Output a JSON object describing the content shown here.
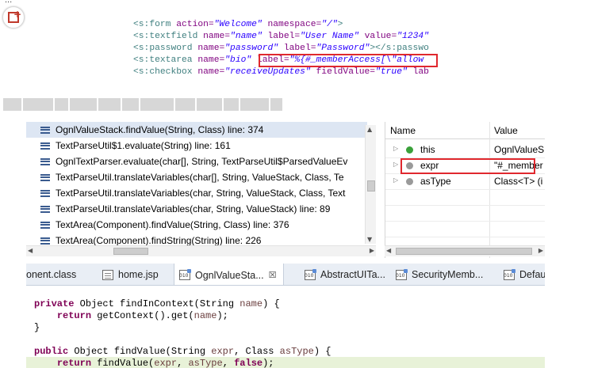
{
  "top_fragment": "...",
  "jsp_code": {
    "lines": [
      [
        {
          "c": "tag",
          "t": "<s:form "
        },
        {
          "c": "attr",
          "t": "action="
        },
        {
          "c": "val",
          "t": "\"Welcome\""
        },
        {
          "c": "plain",
          "t": " "
        },
        {
          "c": "attr",
          "t": "namespace="
        },
        {
          "c": "val",
          "t": "\"/\""
        },
        {
          "c": "tag",
          "t": ">"
        }
      ],
      [
        {
          "c": "tag",
          "t": "<s:textfield "
        },
        {
          "c": "attr",
          "t": "name="
        },
        {
          "c": "val",
          "t": "\"name\""
        },
        {
          "c": "plain",
          "t": " "
        },
        {
          "c": "attr",
          "t": "label="
        },
        {
          "c": "val",
          "t": "\"User Name\""
        },
        {
          "c": "plain",
          "t": " "
        },
        {
          "c": "attr",
          "t": "value="
        },
        {
          "c": "val",
          "t": "\"1234\""
        }
      ],
      [
        {
          "c": "tag",
          "t": "<s:password "
        },
        {
          "c": "attr",
          "t": "name="
        },
        {
          "c": "val",
          "t": "\"password\""
        },
        {
          "c": "plain",
          "t": " "
        },
        {
          "c": "attr",
          "t": "label="
        },
        {
          "c": "val",
          "t": "\"Password\""
        },
        {
          "c": "tag",
          "t": "></s:passwo"
        }
      ],
      [
        {
          "c": "tag",
          "t": "<s:textarea "
        },
        {
          "c": "attr",
          "t": "name="
        },
        {
          "c": "val",
          "t": "\"bio\""
        },
        {
          "c": "plain",
          "t": " "
        },
        {
          "c": "attr",
          "t": "label="
        },
        {
          "c": "val",
          "t": "\"%{#_memberAccess[\\\"allow"
        }
      ],
      [
        {
          "c": "tag",
          "t": "<s:checkbox "
        },
        {
          "c": "attr",
          "t": "name="
        },
        {
          "c": "val",
          "t": "\"receiveUpdates\""
        },
        {
          "c": "plain",
          "t": " "
        },
        {
          "c": "attr",
          "t": "fieldValue="
        },
        {
          "c": "val",
          "t": "\"true\""
        },
        {
          "c": "plain",
          "t": " "
        },
        {
          "c": "attr",
          "t": "lab"
        }
      ]
    ]
  },
  "call_stack": {
    "frames": [
      "OgnlValueStack.findValue(String, Class) line: 374",
      "TextParseUtil$1.evaluate(String) line: 161",
      "OgnlTextParser.evaluate(char[], String, TextParseUtil$ParsedValueEv",
      "TextParseUtil.translateVariables(char[], String, ValueStack, Class, Te",
      "TextParseUtil.translateVariables(char, String, ValueStack, Class, Text",
      "TextParseUtil.translateVariables(char, String, ValueStack) line: 89",
      "TextArea(Component).findValue(String, Class) line: 376",
      "TextArea(Component).findString(String) line: 226"
    ],
    "selected_index": 0
  },
  "variables": {
    "header_name": "Name",
    "header_value": "Value",
    "rows": [
      {
        "name": "this",
        "value": "OgnlValueS",
        "dot_color": "#3aa13a"
      },
      {
        "name": "expr",
        "value": "\"#_member",
        "dot_color": "#9a9a9a"
      },
      {
        "name": "asType",
        "value": "Class<T> (i",
        "dot_color": "#9a9a9a"
      }
    ]
  },
  "tabs": [
    {
      "label": "onent.class",
      "icon": "class-file-icon",
      "active": false
    },
    {
      "label": "home.jsp",
      "icon": "jsp-file-icon",
      "active": false
    },
    {
      "label": "OgnlValueSta...",
      "icon": "class-file-icon",
      "active": true,
      "close": "☒"
    },
    {
      "label": "AbstractUITa...",
      "icon": "class-file-icon",
      "active": false
    },
    {
      "label": "SecurityMemb...",
      "icon": "class-file-icon",
      "active": false
    },
    {
      "label": "Defau",
      "icon": "class-file-icon",
      "active": false
    }
  ],
  "java_code": {
    "lines": [
      [
        {
          "c": "kw",
          "t": "private"
        },
        {
          "c": "cl",
          "t": " Object findInContext(String "
        },
        {
          "c": "pv",
          "t": "name"
        },
        {
          "c": "cl",
          "t": ") {"
        }
      ],
      [
        {
          "c": "cl",
          "t": "    "
        },
        {
          "c": "kw",
          "t": "return"
        },
        {
          "c": "cl",
          "t": " getContext().get("
        },
        {
          "c": "pv",
          "t": "name"
        },
        {
          "c": "cl",
          "t": ");"
        }
      ],
      [
        {
          "c": "cl",
          "t": "}"
        }
      ],
      [
        {
          "c": "cl",
          "t": ""
        }
      ],
      [
        {
          "c": "kw",
          "t": "public"
        },
        {
          "c": "cl",
          "t": " Object findValue(String "
        },
        {
          "c": "pv",
          "t": "expr"
        },
        {
          "c": "cl",
          "t": ", Class "
        },
        {
          "c": "pv",
          "t": "asType"
        },
        {
          "c": "cl",
          "t": ") {"
        }
      ],
      [
        {
          "c": "cl",
          "t": "    "
        },
        {
          "c": "kw",
          "t": "return"
        },
        {
          "c": "cl",
          "t": " findValue("
        },
        {
          "c": "pv",
          "t": "expr"
        },
        {
          "c": "cl",
          "t": ", "
        },
        {
          "c": "pv",
          "t": "asType"
        },
        {
          "c": "cl",
          "t": ", "
        },
        {
          "c": "kw",
          "t": "false"
        },
        {
          "c": "cl",
          "t": ");"
        }
      ]
    ],
    "current_line_index": 5
  },
  "colors": {
    "highlight_box": "#e0282e",
    "selected_frame": "#dde6f3",
    "current_line": "#e8f2d8"
  }
}
